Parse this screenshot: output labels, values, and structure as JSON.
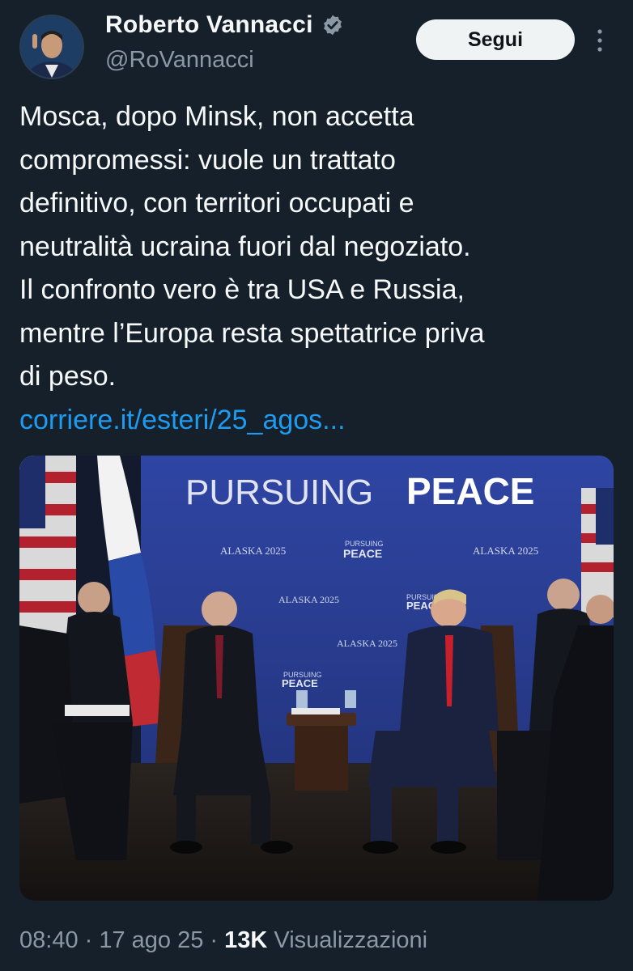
{
  "author": {
    "display_name": "Roberto Vannacci",
    "handle": "@RoVannacci",
    "verified_icon": "verified-badge-icon",
    "avatar_icon": "avatar"
  },
  "actions": {
    "follow_label": "Segui",
    "more_icon": "more-vertical-icon"
  },
  "tweet": {
    "lines": [
      "Mosca, dopo Minsk, non accetta",
      "compromessi: vuole un trattato",
      "definitivo, con territori occupati e",
      "neutralità ucraina fuori dal negoziato.",
      "Il confronto vero è tra USA e Russia,",
      "mentre l’Europa resta spettatrice priva",
      "di peso."
    ],
    "link": "corriere.it/esteri/25_agos..."
  },
  "photo": {
    "banner_part1": "PURSUING ",
    "banner_part2": "PEACE",
    "backdrop_text": [
      "ALASKA 2025",
      "PURSUING",
      "PEACE"
    ]
  },
  "meta": {
    "time": "08:40",
    "separator1": " · ",
    "date": "17 ago 25",
    "separator2": " · ",
    "views_count": "13K",
    "views_label": " Visualizzazioni"
  },
  "colors": {
    "background": "#15202b",
    "text": "#f7f9f9",
    "secondary": "#8b98a5",
    "link": "#1d9bf0",
    "verified": "#8b98a5",
    "backdrop": "#2b3f95"
  }
}
